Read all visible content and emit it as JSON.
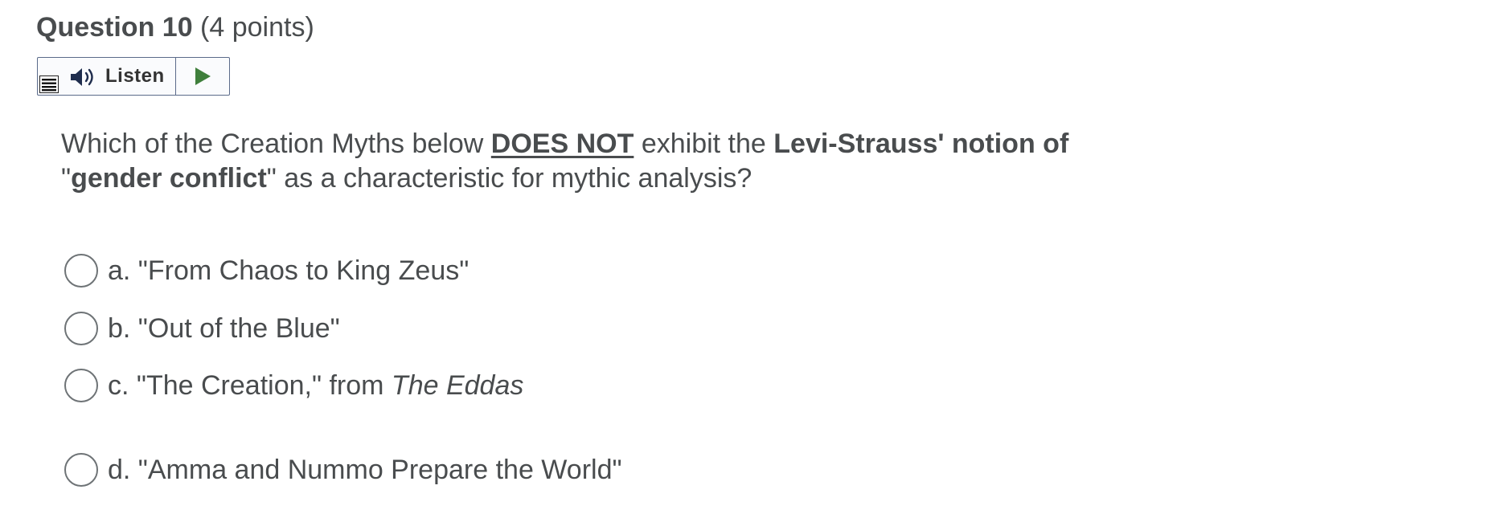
{
  "question": {
    "title": "Question 10",
    "points": " (4 points)"
  },
  "listen": {
    "label": "Listen"
  },
  "prompt": {
    "part1": "Which of the Creation Myths below ",
    "emphasis_not": "DOES NOT",
    "part2": " exhibit the ",
    "emphasis_notion": "Levi-Strauss' notion of",
    "part3": "\"",
    "emphasis_gender": "gender conflict",
    "part4": "\" as a characteristic for mythic analysis?"
  },
  "options": [
    {
      "label": "a. \"From Chaos to King Zeus\""
    },
    {
      "label": "b. \"Out of the Blue\""
    },
    {
      "label": "c. \"The Creation,\" from ",
      "italic": "The Eddas"
    },
    {
      "label": "d. \"Amma and Nummo Prepare the World\""
    }
  ],
  "icons": {
    "menu": "menu-icon",
    "speaker": "speaker-icon",
    "play": "play-icon"
  },
  "colors": {
    "text": "#494c4e",
    "play_green": "#3f7f3c",
    "border": "#5b6b8a"
  }
}
